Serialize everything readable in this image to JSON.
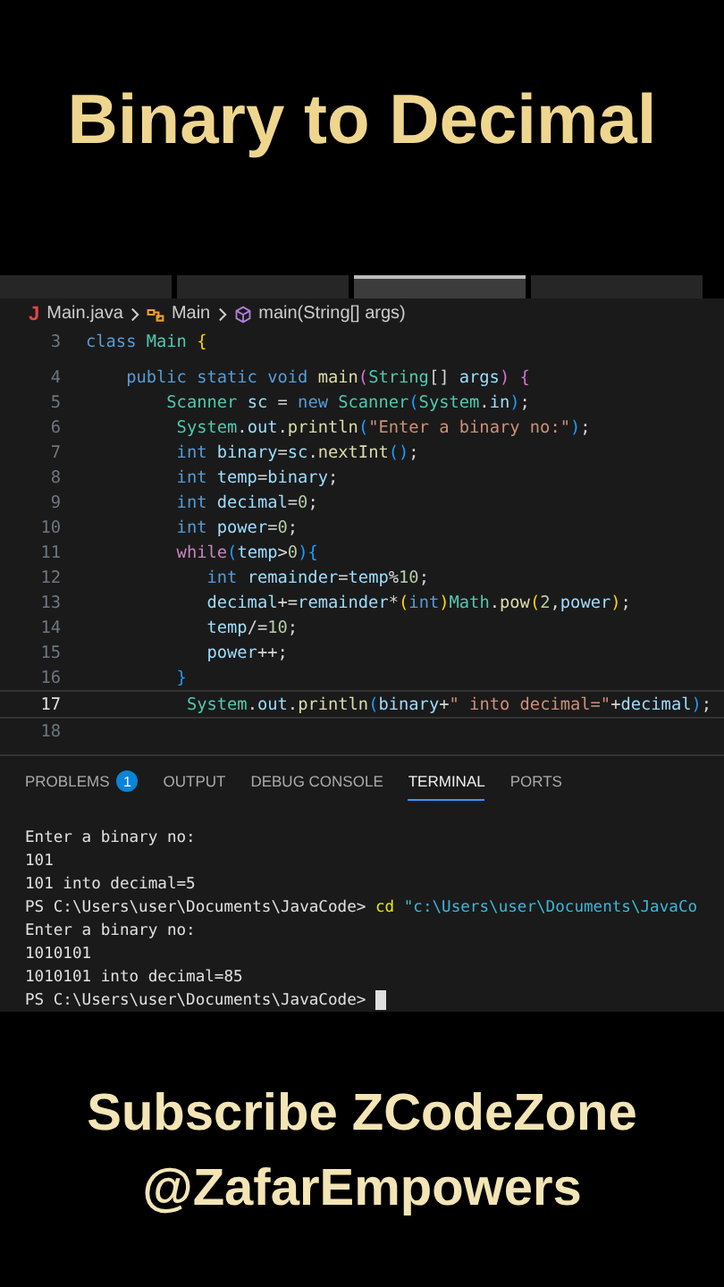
{
  "title": "Binary to Decimal",
  "editor_tabs": [
    {
      "selected": false
    },
    {
      "selected": false
    },
    {
      "selected": true
    },
    {
      "selected": false
    }
  ],
  "breadcrumb": {
    "file_icon": "J",
    "file": "Main.java",
    "class": "Main",
    "method": "main(String[] args)"
  },
  "code_lines": [
    {
      "number": "3",
      "current": false,
      "tokens": [
        {
          "t": "class ",
          "kind": "k"
        },
        {
          "t": "Main ",
          "kind": "t"
        },
        {
          "t": "{",
          "kind": "b1"
        }
      ]
    },
    {
      "number": "4",
      "current": false,
      "tokens": [
        {
          "t": "    public static void ",
          "kind": "k"
        },
        {
          "t": "main",
          "kind": "f"
        },
        {
          "t": "(",
          "kind": "b2"
        },
        {
          "t": "String",
          "kind": "t"
        },
        {
          "t": "[] ",
          "kind": "p"
        },
        {
          "t": "args",
          "kind": "v"
        },
        {
          "t": ") {",
          "kind": "b2"
        }
      ]
    },
    {
      "number": "5",
      "current": false,
      "tokens": [
        {
          "t": "        Scanner ",
          "kind": "t"
        },
        {
          "t": "sc",
          "kind": "v"
        },
        {
          "t": " = ",
          "kind": "p"
        },
        {
          "t": "new ",
          "kind": "k"
        },
        {
          "t": "Scanner",
          "kind": "t"
        },
        {
          "t": "(",
          "kind": "b3"
        },
        {
          "t": "System",
          "kind": "t"
        },
        {
          "t": ".",
          "kind": "p"
        },
        {
          "t": "in",
          "kind": "v"
        },
        {
          "t": ")",
          "kind": "b3"
        },
        {
          "t": ";",
          "kind": "p"
        }
      ]
    },
    {
      "number": "6",
      "current": false,
      "tokens": [
        {
          "t": "         System",
          "kind": "t"
        },
        {
          "t": ".",
          "kind": "p"
        },
        {
          "t": "out",
          "kind": "v"
        },
        {
          "t": ".",
          "kind": "p"
        },
        {
          "t": "println",
          "kind": "f"
        },
        {
          "t": "(",
          "kind": "b3"
        },
        {
          "t": "\"Enter a binary no:\"",
          "kind": "s"
        },
        {
          "t": ")",
          "kind": "b3"
        },
        {
          "t": ";",
          "kind": "p"
        }
      ]
    },
    {
      "number": "7",
      "current": false,
      "tokens": [
        {
          "t": "         int ",
          "kind": "k"
        },
        {
          "t": "binary",
          "kind": "v"
        },
        {
          "t": "=",
          "kind": "p"
        },
        {
          "t": "sc",
          "kind": "v"
        },
        {
          "t": ".",
          "kind": "p"
        },
        {
          "t": "nextInt",
          "kind": "f"
        },
        {
          "t": "()",
          "kind": "b3"
        },
        {
          "t": ";",
          "kind": "p"
        }
      ]
    },
    {
      "number": "8",
      "current": false,
      "tokens": [
        {
          "t": "         int ",
          "kind": "k"
        },
        {
          "t": "temp",
          "kind": "v"
        },
        {
          "t": "=",
          "kind": "p"
        },
        {
          "t": "binary",
          "kind": "v"
        },
        {
          "t": ";",
          "kind": "p"
        }
      ]
    },
    {
      "number": "9",
      "current": false,
      "tokens": [
        {
          "t": "         int ",
          "kind": "k"
        },
        {
          "t": "decimal",
          "kind": "v"
        },
        {
          "t": "=",
          "kind": "p"
        },
        {
          "t": "0",
          "kind": "n"
        },
        {
          "t": ";",
          "kind": "p"
        }
      ]
    },
    {
      "number": "10",
      "current": false,
      "tokens": [
        {
          "t": "         int ",
          "kind": "k"
        },
        {
          "t": "power",
          "kind": "v"
        },
        {
          "t": "=",
          "kind": "p"
        },
        {
          "t": "0",
          "kind": "n"
        },
        {
          "t": ";",
          "kind": "p"
        }
      ]
    },
    {
      "number": "11",
      "current": false,
      "tokens": [
        {
          "t": "         while",
          "kind": "c"
        },
        {
          "t": "(",
          "kind": "b3"
        },
        {
          "t": "temp",
          "kind": "v"
        },
        {
          "t": ">",
          "kind": "p"
        },
        {
          "t": "0",
          "kind": "n"
        },
        {
          "t": "){",
          "kind": "b3"
        }
      ]
    },
    {
      "number": "12",
      "current": false,
      "tokens": [
        {
          "t": "            int ",
          "kind": "k"
        },
        {
          "t": "remainder",
          "kind": "v"
        },
        {
          "t": "=",
          "kind": "p"
        },
        {
          "t": "temp",
          "kind": "v"
        },
        {
          "t": "%",
          "kind": "p"
        },
        {
          "t": "10",
          "kind": "n"
        },
        {
          "t": ";",
          "kind": "p"
        }
      ]
    },
    {
      "number": "13",
      "current": false,
      "tokens": [
        {
          "t": "            decimal",
          "kind": "v"
        },
        {
          "t": "+=",
          "kind": "p"
        },
        {
          "t": "remainder",
          "kind": "v"
        },
        {
          "t": "*",
          "kind": "p"
        },
        {
          "t": "(",
          "kind": "b1"
        },
        {
          "t": "int",
          "kind": "k"
        },
        {
          "t": ")",
          "kind": "b1"
        },
        {
          "t": "Math",
          "kind": "t"
        },
        {
          "t": ".",
          "kind": "p"
        },
        {
          "t": "pow",
          "kind": "f"
        },
        {
          "t": "(",
          "kind": "b1"
        },
        {
          "t": "2",
          "kind": "n"
        },
        {
          "t": ",",
          "kind": "p"
        },
        {
          "t": "power",
          "kind": "v"
        },
        {
          "t": ")",
          "kind": "b1"
        },
        {
          "t": ";",
          "kind": "p"
        }
      ]
    },
    {
      "number": "14",
      "current": false,
      "tokens": [
        {
          "t": "            temp",
          "kind": "v"
        },
        {
          "t": "/=",
          "kind": "p"
        },
        {
          "t": "10",
          "kind": "n"
        },
        {
          "t": ";",
          "kind": "p"
        }
      ]
    },
    {
      "number": "15",
      "current": false,
      "tokens": [
        {
          "t": "            power",
          "kind": "v"
        },
        {
          "t": "++;",
          "kind": "p"
        }
      ]
    },
    {
      "number": "16",
      "current": false,
      "tokens": [
        {
          "t": "         }",
          "kind": "b3"
        }
      ]
    },
    {
      "number": "17",
      "current": true,
      "tokens": [
        {
          "t": "          System",
          "kind": "t"
        },
        {
          "t": ".",
          "kind": "p"
        },
        {
          "t": "out",
          "kind": "v"
        },
        {
          "t": ".",
          "kind": "p"
        },
        {
          "t": "println",
          "kind": "f"
        },
        {
          "t": "(",
          "kind": "b3"
        },
        {
          "t": "binary",
          "kind": "v"
        },
        {
          "t": "+",
          "kind": "p"
        },
        {
          "t": "\" into decimal=\"",
          "kind": "s"
        },
        {
          "t": "+",
          "kind": "p"
        },
        {
          "t": "decimal",
          "kind": "v"
        },
        {
          "t": ")",
          "kind": "b3"
        },
        {
          "t": ";",
          "kind": "p"
        }
      ]
    },
    {
      "number": "18",
      "current": false
    }
  ],
  "panel_tabs": [
    {
      "label": "PROBLEMS",
      "badge": "1",
      "selected": false
    },
    {
      "label": "OUTPUT",
      "selected": false
    },
    {
      "label": "DEBUG CONSOLE",
      "selected": false
    },
    {
      "label": "TERMINAL",
      "selected": true
    },
    {
      "label": "PORTS",
      "selected": false
    }
  ],
  "terminal_lines": [
    {
      "cursor": false,
      "parts": [
        {
          "t": "Enter a binary no:",
          "kind": "out"
        }
      ]
    },
    {
      "cursor": false,
      "parts": [
        {
          "t": "101",
          "kind": "out"
        }
      ]
    },
    {
      "cursor": false,
      "parts": [
        {
          "t": "101 into decimal=5",
          "kind": "out"
        }
      ]
    },
    {
      "cursor": false,
      "parts": [
        {
          "t": "PS C:\\Users\\user\\Documents\\JavaCode> ",
          "kind": "out"
        },
        {
          "t": "cd",
          "kind": "cmd"
        },
        {
          "t": " \"c:\\Users\\user\\Documents\\JavaCo",
          "kind": "arg"
        }
      ]
    },
    {
      "cursor": false,
      "parts": [
        {
          "t": "Enter a binary no:",
          "kind": "out"
        }
      ]
    },
    {
      "cursor": false,
      "parts": [
        {
          "t": "1010101",
          "kind": "out"
        }
      ]
    },
    {
      "cursor": false,
      "parts": [
        {
          "t": "1010101 into decimal=85",
          "kind": "out"
        }
      ]
    },
    {
      "cursor": true,
      "parts": [
        {
          "t": "PS C:\\Users\\user\\Documents\\JavaCode> ",
          "kind": "out"
        }
      ]
    }
  ],
  "footer": [
    "Subscribe ZCodeZone",
    "@ZafarEmpowers"
  ]
}
